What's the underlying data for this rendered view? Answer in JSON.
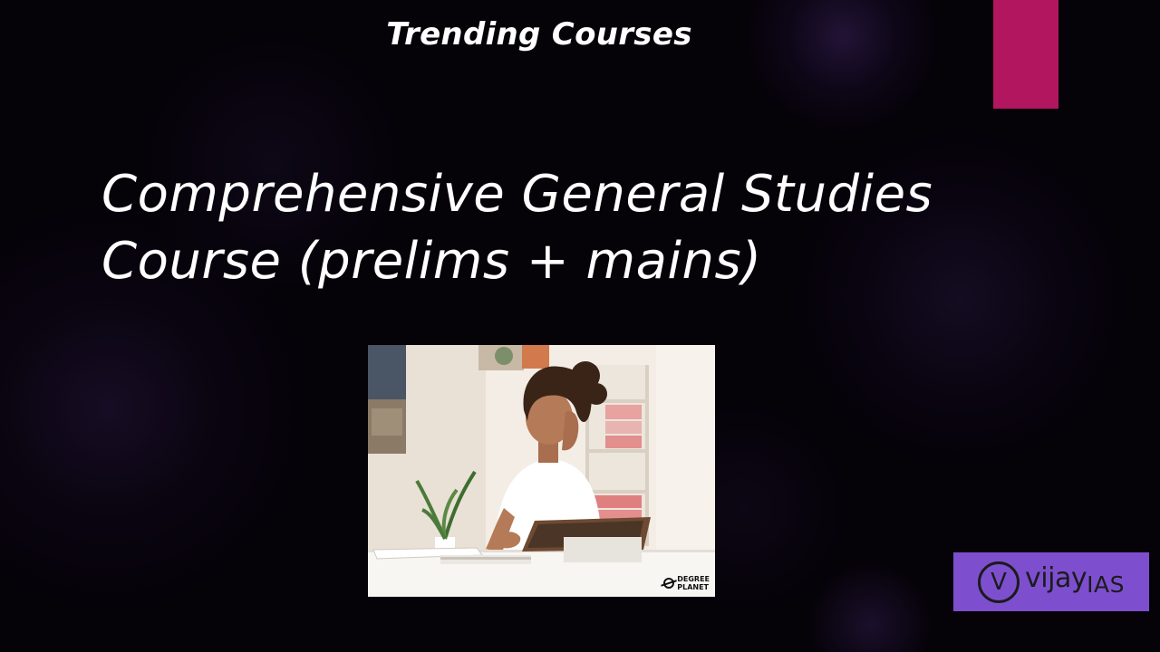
{
  "slide": {
    "heading": "Trending Courses",
    "course_title_line1": "Comprehensive General Studies",
    "course_title_line2": "Course (prelims + mains)",
    "accent_color": "#b1165f"
  },
  "photo": {
    "brand_line1": "DEGREE",
    "brand_line2": "PLANET"
  },
  "logo": {
    "letter": "V",
    "name": "vijay",
    "suffix": "IAS",
    "background_color": "#7d4fcf"
  }
}
